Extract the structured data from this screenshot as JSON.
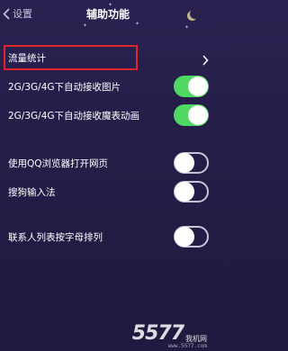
{
  "navbar": {
    "back_label": "设置",
    "title": "辅助功能"
  },
  "rows": [
    {
      "label": "流量统计",
      "control": "chevron",
      "highlighted": true
    },
    {
      "label": "2G/3G/4G下自动接收图片",
      "control": "toggle",
      "on": true
    },
    {
      "label": "2G/3G/4G下自动接收魔表动画",
      "control": "toggle",
      "on": true
    },
    {
      "label": "使用QQ浏览器打开网页",
      "control": "toggle",
      "on": false
    },
    {
      "label": "搜狗输入法",
      "control": "toggle",
      "on": false
    },
    {
      "label": "联系人列表按字母排列",
      "control": "toggle",
      "on": false
    }
  ],
  "watermark": {
    "number": "5577",
    "sub": "我机网",
    "url": "www.5577.com"
  },
  "colors": {
    "background": "#241d47",
    "toggle_on": "#4fd862",
    "highlight_border": "#e0242c"
  }
}
